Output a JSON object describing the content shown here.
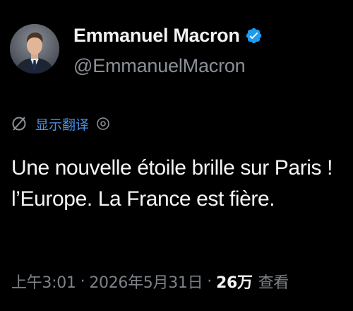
{
  "author": {
    "display_name": "Emmanuel Macron",
    "handle": "@EmmanuelMacron",
    "verified": true
  },
  "translate": {
    "label": "显示翻译"
  },
  "tweet": {
    "lines": [
      "Une nouvelle étoile brille sur Paris !",
      "l’Europe. La France est fière."
    ]
  },
  "meta": {
    "time": "上午3:01",
    "separator": "·",
    "date": "2026年5月31日",
    "views_count": "26万",
    "views_label": "查看"
  },
  "colors": {
    "background": "#000000",
    "verified_badge": "#1d9bf0",
    "translate_link": "#4a8fe0",
    "secondary_text": "#7d8289"
  },
  "icons": {
    "verified": "verified-badge-icon",
    "translate": "translate-icon",
    "info": "info-icon"
  }
}
